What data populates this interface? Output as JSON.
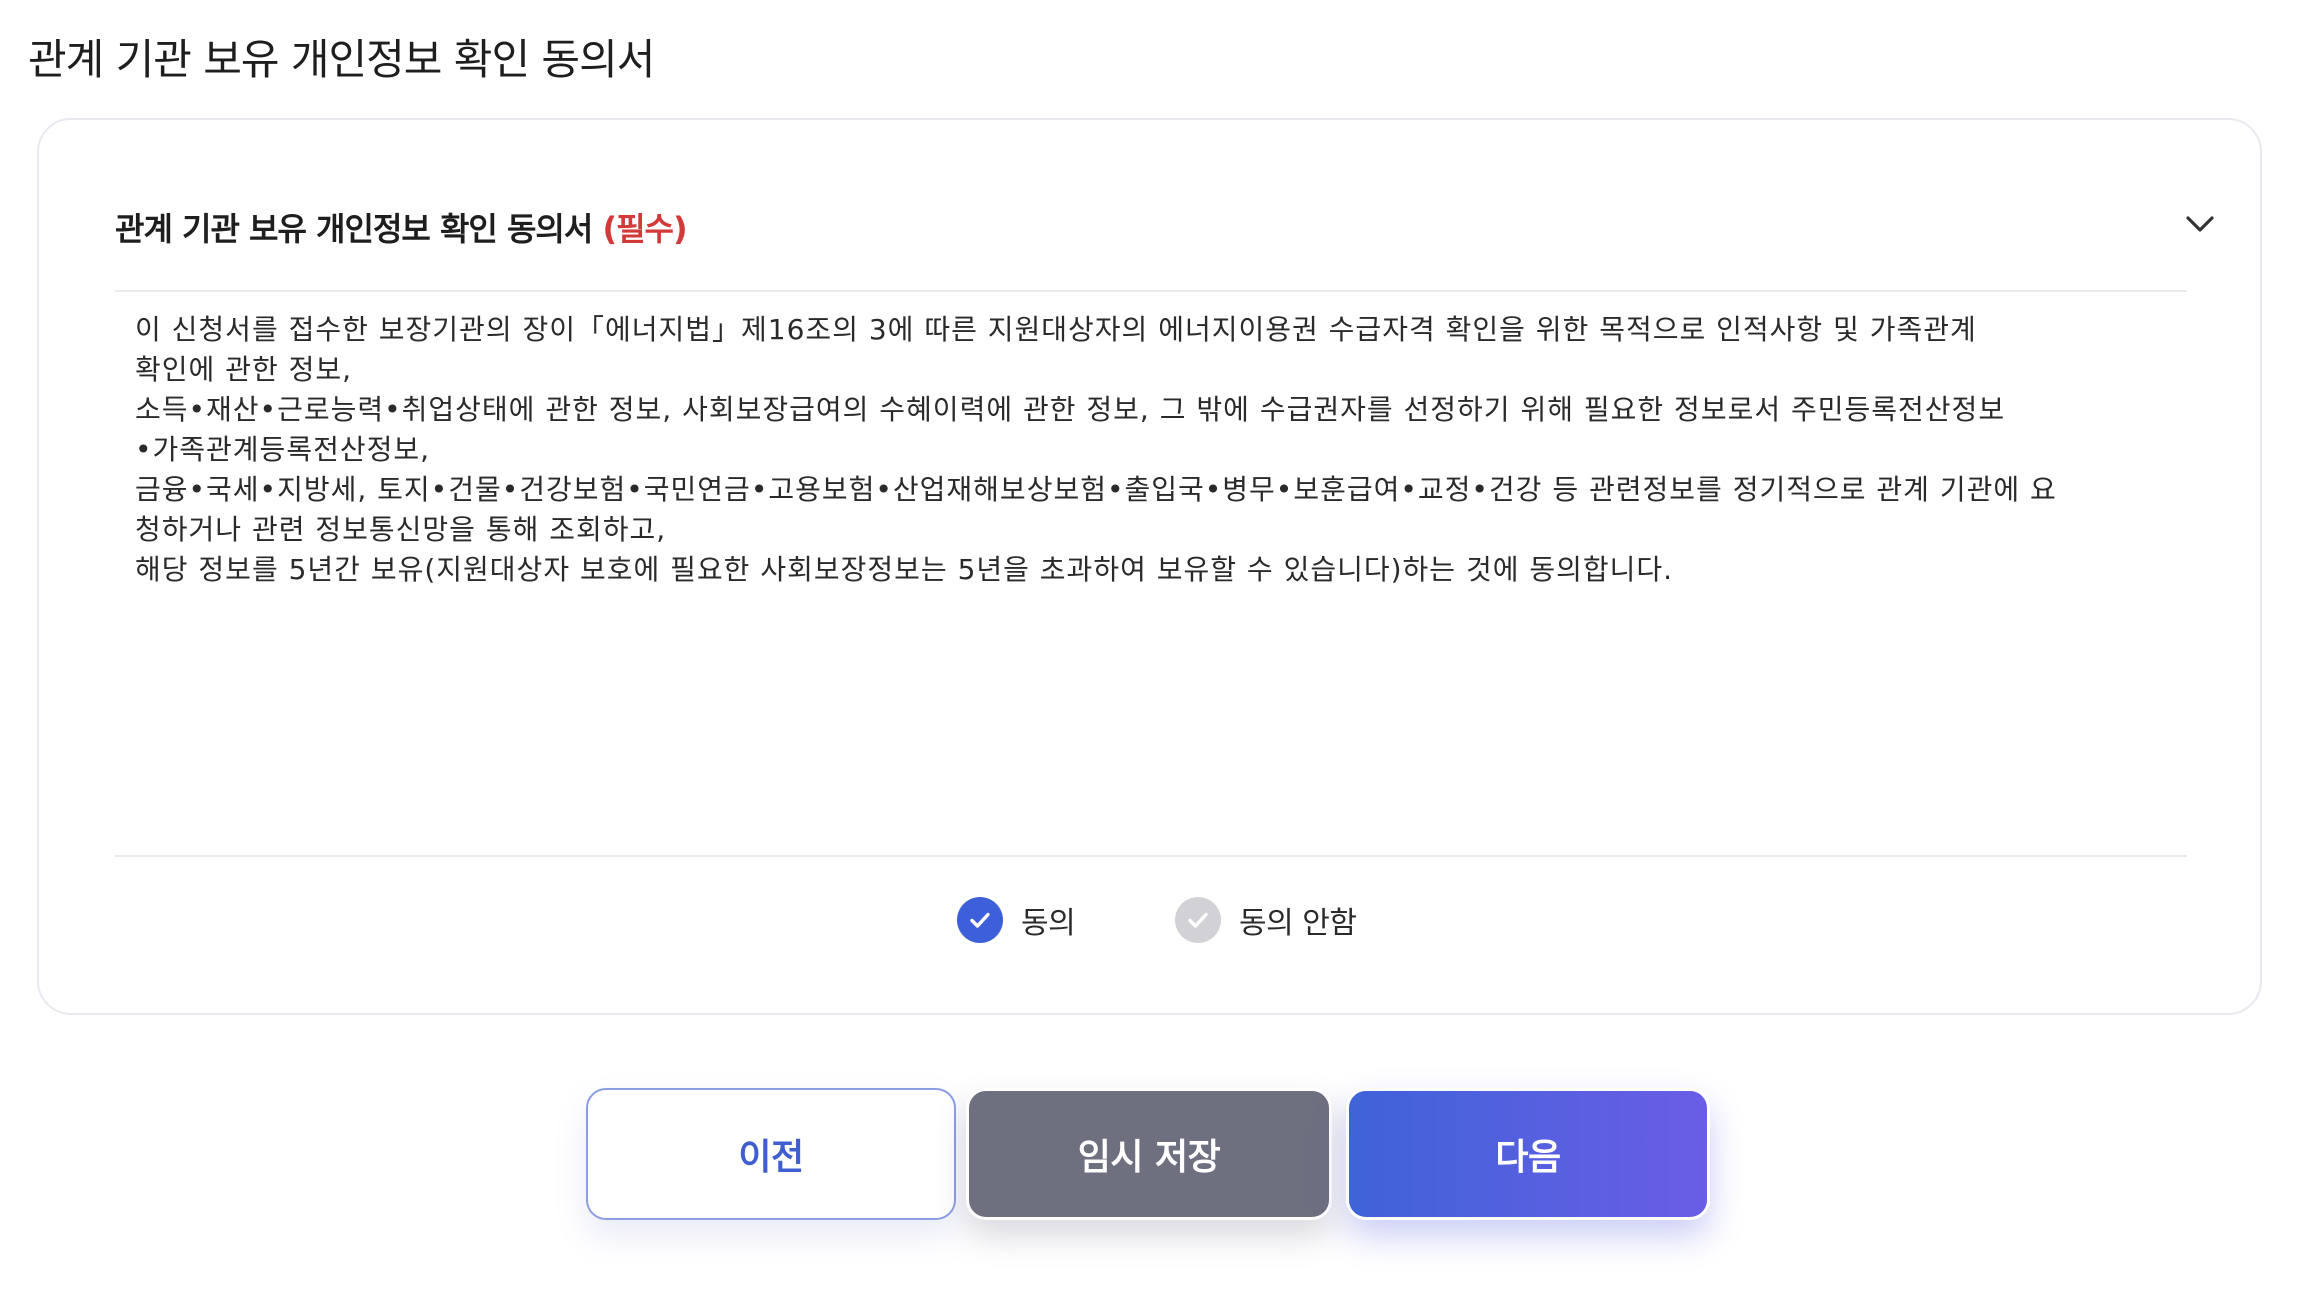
{
  "page": {
    "title": "관계 기관 보유 개인정보 확인 동의서"
  },
  "consent": {
    "title": "관계 기관 보유 개인정보 확인 동의서",
    "required_label": "(필수)",
    "expanded": true,
    "body_lines": [
      "이 신청서를 접수한 보장기관의 장이「에너지법」제16조의 3에 따른 지원대상자의 에너지이용권 수급자격 확인을 위한 목적으로 인적사항 및 가족관계",
      "확인에 관한 정보,",
      "소득•재산•근로능력•취업상태에 관한 정보, 사회보장급여의 수혜이력에 관한 정보, 그 밖에 수급권자를 선정하기 위해 필요한 정보로서 주민등록전산정보",
      "•가족관계등록전산정보,",
      "금융•국세•지방세, 토지•건물•건강보험•국민연금•고용보험•산업재해보상보험•출입국•병무•보훈급여•교정•건강 등 관련정보를 정기적으로 관계 기관에 요",
      "청하거나 관련 정보통신망을 통해 조회하고,",
      "해당 정보를 5년간 보유(지원대상자 보호에 필요한 사회보장정보는 5년을 초과하여 보유할 수 있습니다)하는 것에 동의합니다."
    ],
    "options": {
      "agree": "동의",
      "disagree": "동의 안함"
    },
    "selected": "agree"
  },
  "buttons": {
    "prev": "이전",
    "save": "임시 저장",
    "next": "다음"
  },
  "colors": {
    "accent": "#3d5fd9",
    "required": "#d23a3a",
    "save_button": "#6e6f7f",
    "next_gradient_start": "#3f63d8",
    "next_gradient_end": "#6a5de6",
    "unselected_radio": "#d2d2d6"
  },
  "icons": {
    "expand": "chevron-down-icon",
    "selected_check": "check-circle-icon",
    "unselected_check": "check-circle-icon"
  }
}
